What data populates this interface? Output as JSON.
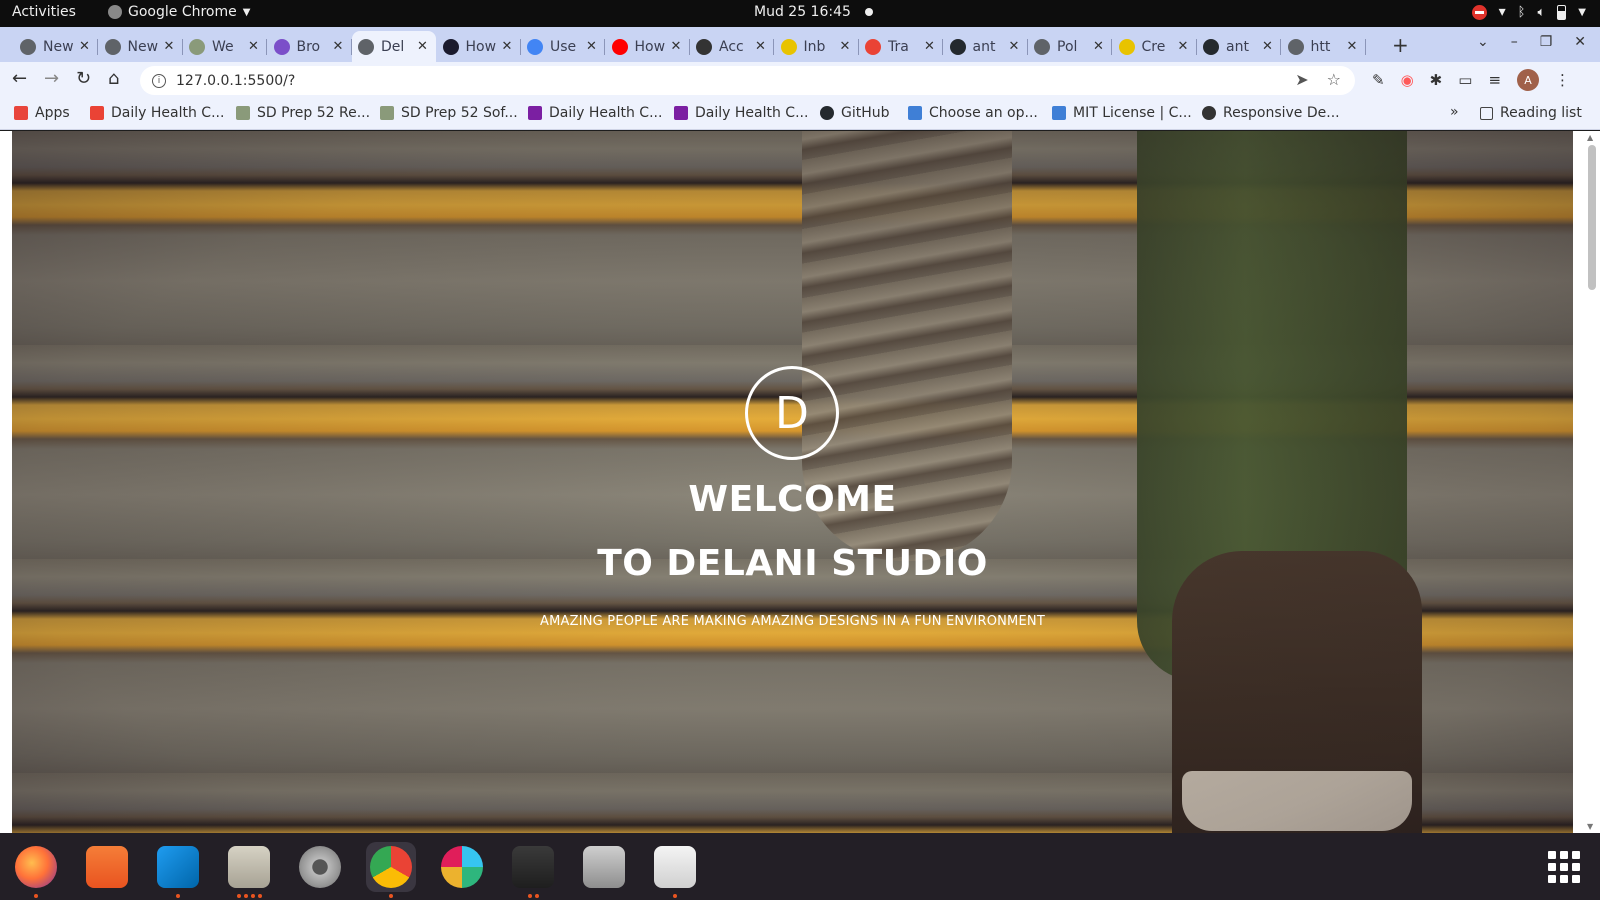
{
  "topbar": {
    "activities": "Activities",
    "app_name": "Google Chrome",
    "datetime": "Mud 25  16:45"
  },
  "tabs": [
    {
      "label": "New",
      "color": "#5f6368",
      "icon": "chrome-newtab-icon"
    },
    {
      "label": "New",
      "color": "#5f6368",
      "icon": "chrome-newtab-icon"
    },
    {
      "label": "We",
      "color": "#8a9a7a",
      "icon": "tree-icon"
    },
    {
      "label": "Bro",
      "color": "#7b4fc9",
      "icon": "colorful-grid-icon"
    },
    {
      "label": "Del",
      "color": "#5f6368",
      "icon": "globe-icon",
      "active": true
    },
    {
      "label": "How",
      "color": "#1a1a2e",
      "icon": "a-logo-icon"
    },
    {
      "label": "Use",
      "color": "#4285f4",
      "icon": "google-g-icon"
    },
    {
      "label": "How",
      "color": "#ff0000",
      "icon": "youtube-icon"
    },
    {
      "label": "Acc",
      "color": "#333333",
      "icon": "coin-icon"
    },
    {
      "label": "Inb",
      "color": "#e8c300",
      "icon": "yellow-coin-icon"
    },
    {
      "label": "Tra",
      "color": "#ea4335",
      "icon": "gmail-icon"
    },
    {
      "label": "ant",
      "color": "#24292e",
      "icon": "github-icon"
    },
    {
      "label": "Pol",
      "color": "#5f6368",
      "icon": "globe-icon"
    },
    {
      "label": "Cre",
      "color": "#e8c300",
      "icon": "yellow-coin-icon"
    },
    {
      "label": "ant",
      "color": "#24292e",
      "icon": "github-icon"
    },
    {
      "label": "htt",
      "color": "#5f6368",
      "icon": "globe-icon"
    }
  ],
  "omnibox": {
    "url": "127.0.0.1:5500/?"
  },
  "bookmarks": [
    {
      "label": "Apps",
      "icon": "apps-grid-icon",
      "color": "#e8453c"
    },
    {
      "label": "Daily Health C...",
      "icon": "gmail-icon",
      "color": "#ea4335"
    },
    {
      "label": "SD Prep 52 Re...",
      "icon": "tree-icon",
      "color": "#8a9a7a"
    },
    {
      "label": "SD Prep 52 Sof...",
      "icon": "tree-icon",
      "color": "#8a9a7a"
    },
    {
      "label": "Daily Health C...",
      "icon": "form-icon",
      "color": "#7b1fa2"
    },
    {
      "label": "Daily Health C...",
      "icon": "form-icon",
      "color": "#7b1fa2"
    },
    {
      "label": "GitHub",
      "icon": "github-icon",
      "color": "#24292e"
    },
    {
      "label": "Choose an op...",
      "icon": "license-icon",
      "color": "#3f7fd6"
    },
    {
      "label": "MIT License | C...",
      "icon": "license-icon",
      "color": "#3f7fd6"
    },
    {
      "label": "Responsive De...",
      "icon": "globe-icon",
      "color": "#333333"
    }
  ],
  "reading_list": "Reading list",
  "hero": {
    "logo_letter": "D",
    "welcome": "WELCOME",
    "studio": "TO DELANI STUDIO",
    "tagline": "AMAZING PEOPLE ARE MAKING AMAZING DESIGNS IN A FUN ENVIRONMENT"
  },
  "dock": [
    {
      "name": "firefox",
      "icon": "firefox-icon",
      "running": 1
    },
    {
      "name": "ubuntu-software",
      "icon": "software-store-icon",
      "running": 0
    },
    {
      "name": "vscode",
      "icon": "vscode-icon",
      "running": 1
    },
    {
      "name": "files",
      "icon": "files-icon",
      "running": 4
    },
    {
      "name": "settings",
      "icon": "settings-icon",
      "running": 0
    },
    {
      "name": "chrome",
      "icon": "chrome-icon",
      "running": 1,
      "active": true
    },
    {
      "name": "slack",
      "icon": "slack-icon",
      "running": 0
    },
    {
      "name": "terminal",
      "icon": "terminal-icon",
      "running": 2
    },
    {
      "name": "image-viewer",
      "icon": "magnifier-icon",
      "running": 0
    },
    {
      "name": "text-editor",
      "icon": "text-editor-icon",
      "running": 1
    }
  ],
  "colors": {
    "tabstrip": "#c9d4f3",
    "toolbar": "#eef2fd",
    "accent_orange": "#e95420"
  }
}
